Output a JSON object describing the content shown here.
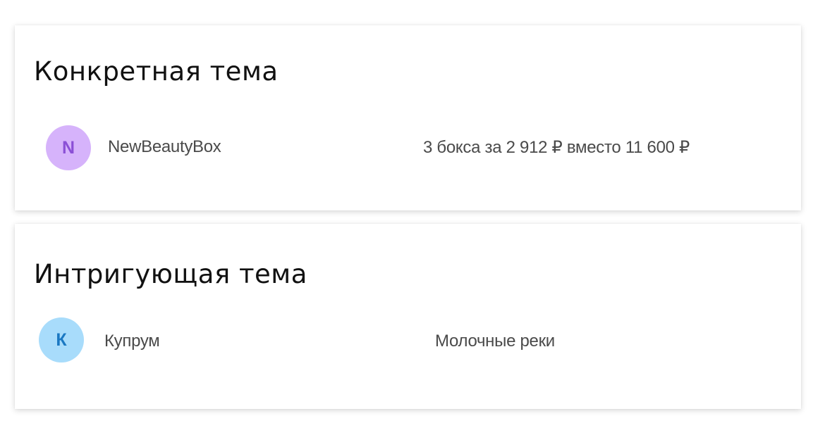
{
  "examples": [
    {
      "title": "Конкретная тема",
      "email": {
        "avatar_letter": "N",
        "avatar_bg": "#d6b3fb",
        "avatar_fg": "#8b4fd6",
        "sender": "NewBeautyBox",
        "subject": "3 бокса за 2 912 ₽ вместо 11 600 ₽"
      }
    },
    {
      "title": "Интригующая тема",
      "email": {
        "avatar_letter": "К",
        "avatar_bg": "#a8dcfb",
        "avatar_fg": "#1a78c2",
        "sender": "Купрум",
        "subject": "Молочные реки"
      }
    }
  ]
}
